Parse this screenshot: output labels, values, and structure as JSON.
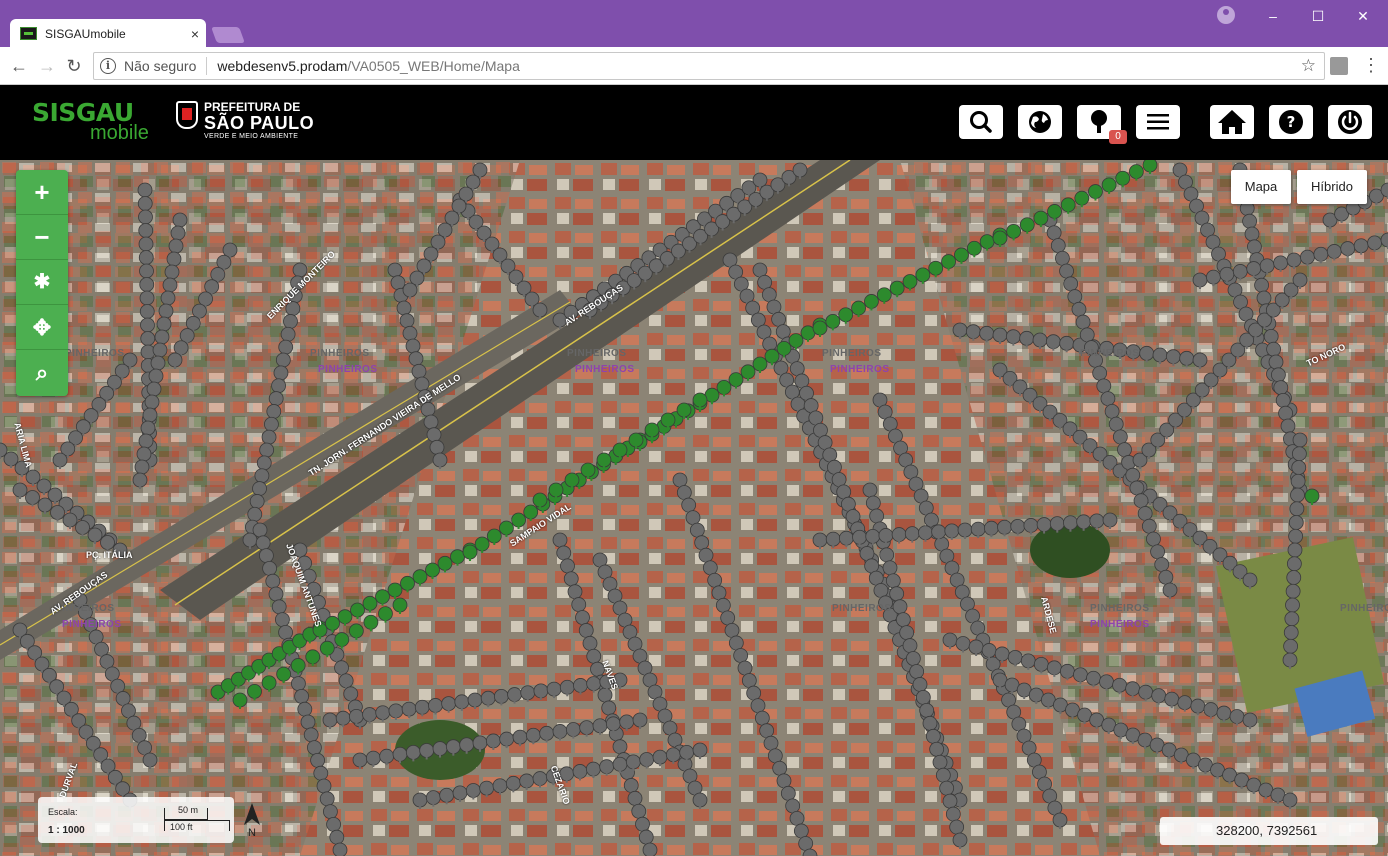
{
  "browser": {
    "tab_title": "SISGAUmobile",
    "tab_close": "×",
    "security_label": "Não seguro",
    "url_host": "webdesenv5.prodam",
    "url_path": "/VA0505_WEB/Home/Mapa",
    "window_controls": {
      "minimize": "–",
      "maximize": "☐",
      "close": "✕"
    }
  },
  "header": {
    "brand_main": "SISGAU",
    "brand_sub": "mobile",
    "pref_line1": "PREFEITURA DE",
    "pref_line2": "SÃO PAULO",
    "pref_line3": "VERDE E MEIO AMBIENTE",
    "tree_badge": "0",
    "buttons": [
      "search-icon",
      "globe-icon",
      "tree-icon",
      "hamburger-menu-icon",
      "home-icon",
      "help-icon",
      "power-icon"
    ]
  },
  "map_controls": {
    "zoom_in": "+",
    "zoom_out": "−",
    "extent": "✱",
    "pan": "✥",
    "search": "⌕"
  },
  "map_types": {
    "mapa": "Mapa",
    "hibrido": "Híbrido"
  },
  "map_labels": {
    "district": "PINHEIROS",
    "streets": [
      "AV. REBOUÇAS",
      "ENRIQUE MONTEIRO",
      "TN. JORN. FERNANDO VIEIRA DE MELLO",
      "SAMPAIO VIDAL",
      "JOAQUIM ANTUNES",
      "AV. REBOUÇAS",
      "PÇ. ITÁLIA",
      "ARIA LIMA",
      "CEZARIO",
      "NAVES",
      "DURVAL",
      "ARDESE",
      "TO NORO"
    ]
  },
  "scale": {
    "label": "Escala:",
    "ratio": "1 : 1000",
    "metric": "50 m",
    "imperial": "100 ft",
    "north": "N"
  },
  "coords": {
    "value": "328200, 7392561"
  },
  "colors": {
    "title_bar": "#7f4fac",
    "header_bg": "#000000",
    "brand_green": "#3aa832",
    "zoom_green": "#4caf50",
    "tree_gray": "#6b6b6b",
    "tree_green": "#2d8a2d"
  }
}
